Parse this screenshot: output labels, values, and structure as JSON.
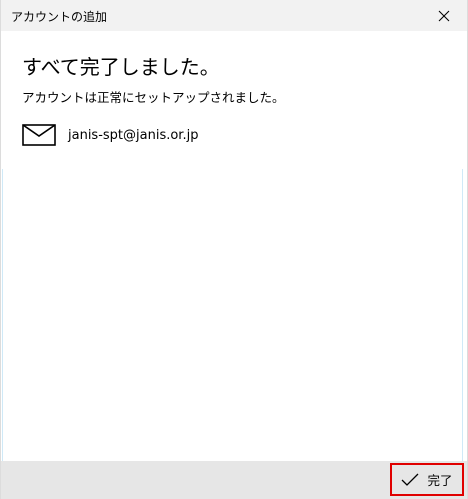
{
  "window": {
    "title": "アカウントの追加"
  },
  "main": {
    "heading": "すべて完了しました。",
    "subtext": "アカウントは正常にセットアップされました。",
    "account": {
      "icon": "mail-icon",
      "email": "janis-spt@janis.or.jp"
    }
  },
  "footer": {
    "done_label": "完了",
    "done_icon": "checkmark-icon"
  },
  "colors": {
    "titlebar_bg": "#f2f2f2",
    "footer_bg": "#e6e6e6",
    "highlight_border": "#e00000",
    "list_border": "#cfe9f7"
  }
}
